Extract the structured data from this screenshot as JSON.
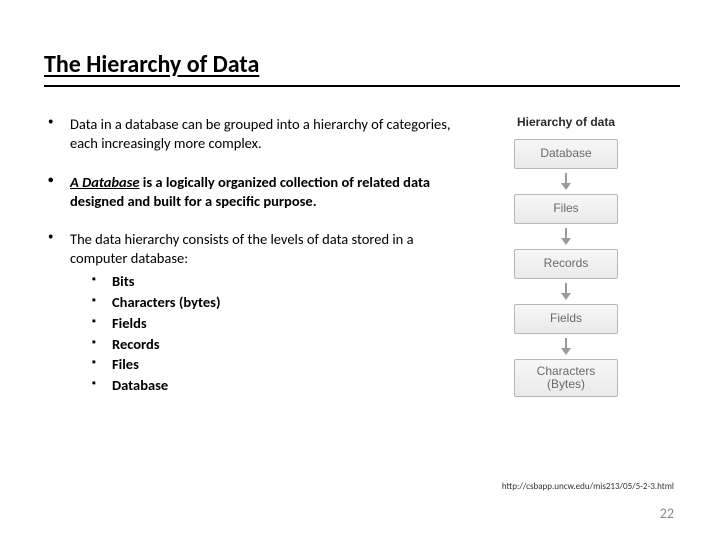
{
  "title": "The Hierarchy of Data",
  "bullets": {
    "b1": "Data in a database can be grouped into a hierarchy of categories, each increasingly more complex.",
    "b2_lead": "A Database",
    "b2_rest": " is a logically organized collection of related data designed and built for a specific purpose.",
    "b3": "The data hierarchy consists of the levels of data stored in a computer database:",
    "sub": {
      "s1": "Bits",
      "s2": "Characters (bytes)",
      "s3": "Fields",
      "s4": "Records",
      "s5": "Files",
      "s6": "Database"
    }
  },
  "diagram": {
    "heading": "Hierarchy of data",
    "levels": {
      "l1": "Database",
      "l2": "Files",
      "l3": "Records",
      "l4": "Fields",
      "l5": "Characters (Bytes)"
    }
  },
  "citation": "http://csbapp.uncw.edu/mis213/05/5-2-3.html",
  "page_number": "22"
}
